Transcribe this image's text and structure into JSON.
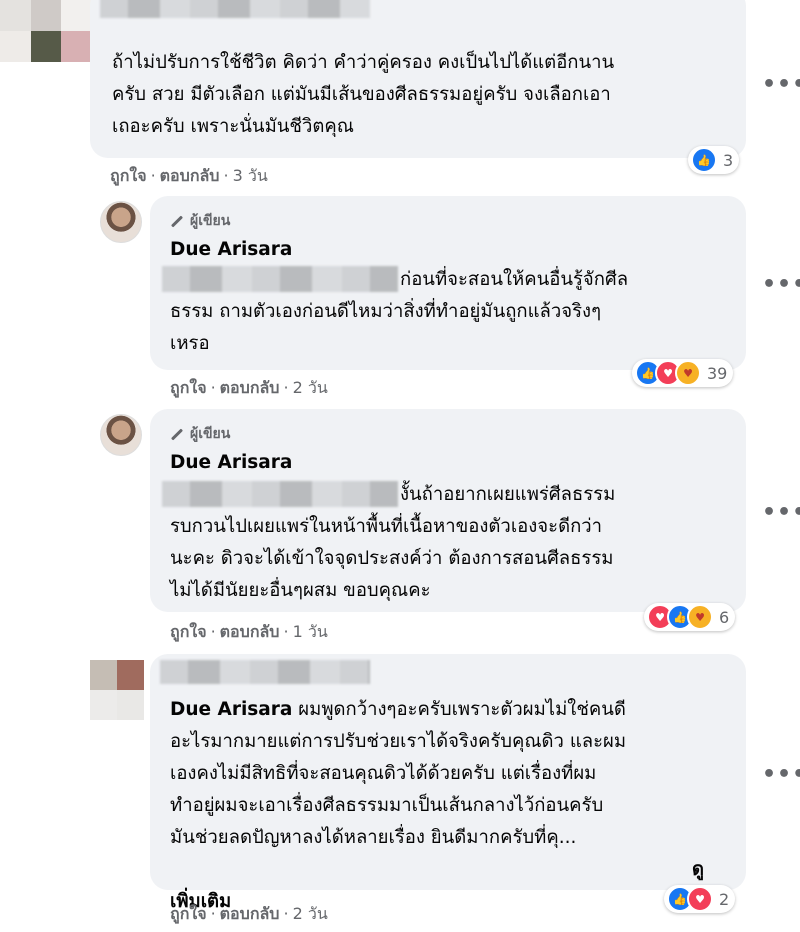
{
  "comments": [
    {
      "author": "",
      "text": "ถ้าไม่ปรับการใช้ชีวิต คิดว่า คำว่าคู่ครอง คงเป็นไปได้แต่อีกนาน\nครับ สวย มีตัวเลือก แต่มันมีเส้นของศีลธรรมอยู่ครับ จงเลือกเอา\nเถอะครับ เพราะนั่นมันชีวิตคุณ",
      "like": "ถูกใจ",
      "reply": "ตอบกลับ",
      "time": "3 วัน",
      "reaction_count": "3",
      "reactions": [
        "like-icon"
      ]
    },
    {
      "badge": "ผู้เขียน",
      "author": "Due Arisara",
      "text": "ก่อนที่จะสอนให้คนอื่นรู้จักศีล\nธรรม ถามตัวเองก่อนดีไหมว่าสิ่งที่ทำอยู่มันถูกแล้วจริงๆ\nเหรอ",
      "like": "ถูกใจ",
      "reply": "ตอบกลับ",
      "time": "2 วัน",
      "reaction_count": "39",
      "reactions": [
        "like-icon",
        "love-icon",
        "care-icon"
      ]
    },
    {
      "badge": "ผู้เขียน",
      "author": "Due Arisara",
      "text": "งั้นถ้าอยากเผยแพร่ศีลธรรม\nรบกวนไปเผยแพร่ในหน้าพื้นที่เนื้อหาของตัวเองจะดีกว่า\nนะคะ ดิวจะได้เข้าใจจุดประสงค์ว่า ต้องการสอนศีลธรรม\nไม่ได้มีนัยยะอื่นๆผสม ขอบคุณคะ",
      "like": "ถูกใจ",
      "reply": "ตอบกลับ",
      "time": "1 วัน",
      "reaction_count": "6",
      "reactions": [
        "love-icon",
        "like-icon",
        "care-icon"
      ]
    },
    {
      "author": "",
      "mention": "Due Arisara",
      "text": " ผมพูดกว้างๆอะครับเพราะตัวผมไม่ใช่คนดี\nอะไรมากมายแต่การปรับช่วยเราได้จริงครับคุณดิว และผม\nเองคงไม่มีสิทธิที่จะสอนคุณดิวได้ด้วยครับ แต่เรื่องที่ผม\nทำอยู่ผมจะเอาเรื่องศีลธรรมมาเป็นเส้นกลางไว้ก่อนครับ\nมันช่วยลดปัญหาลงได้หลายเรื่อง ยินดีมากครับที่คุ...",
      "see_more": "ดู\nเพิ่มเติม",
      "like": "ถูกใจ",
      "reply": "ตอบกลับ",
      "time": "2 วัน",
      "reaction_count": "2",
      "reactions": [
        "like-icon",
        "love-icon"
      ]
    }
  ],
  "more_icon": "•••",
  "colors": {
    "bubble": "#f0f2f5",
    "meta": "#65676b",
    "like": "#1877f2",
    "love": "#f33e58",
    "care": "#f7b125"
  }
}
